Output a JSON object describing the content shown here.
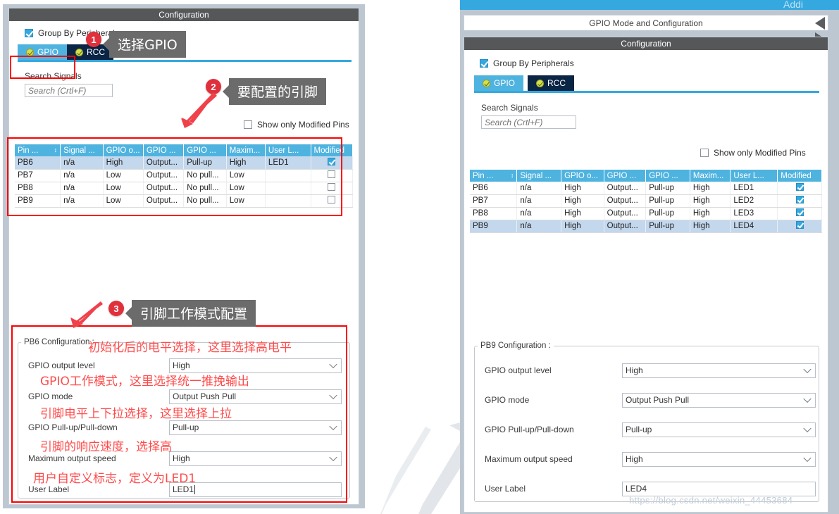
{
  "left_panel": {
    "title_bar": "Configuration",
    "group_by_peripherals": "Group By Peripherals",
    "tabs": [
      {
        "label": "GPIO",
        "state": "active"
      },
      {
        "label": "RCC",
        "state": "inactive"
      }
    ],
    "search_label": "Search Signals",
    "search_placeholder": "Search (Crtl+F)",
    "show_only_modified": "Show only Modified Pins",
    "table": {
      "headers": [
        "Pin ...",
        "Signal ...",
        "GPIO o...",
        "GPIO ...",
        "GPIO ...",
        "Maxim...",
        "User L...",
        "Modified"
      ],
      "sort_column": "Pin ...",
      "rows": [
        {
          "pin": "PB6",
          "signal": "n/a",
          "output_level": "High",
          "mode": "Output...",
          "pull": "Pull-up",
          "speed": "High",
          "user_label": "LED1",
          "modified": true,
          "selected": true
        },
        {
          "pin": "PB7",
          "signal": "n/a",
          "output_level": "Low",
          "mode": "Output...",
          "pull": "No pull...",
          "speed": "Low",
          "user_label": "",
          "modified": false,
          "selected": false
        },
        {
          "pin": "PB8",
          "signal": "n/a",
          "output_level": "Low",
          "mode": "Output...",
          "pull": "No pull...",
          "speed": "Low",
          "user_label": "",
          "modified": false,
          "selected": false
        },
        {
          "pin": "PB9",
          "signal": "n/a",
          "output_level": "Low",
          "mode": "Output...",
          "pull": "No pull...",
          "speed": "Low",
          "user_label": "",
          "modified": false,
          "selected": false
        }
      ]
    },
    "config": {
      "legend": "PB6 Configuration :",
      "fields": [
        {
          "label": "GPIO output level",
          "value": "High",
          "type": "combo"
        },
        {
          "label": "GPIO mode",
          "value": "Output Push Pull",
          "type": "combo"
        },
        {
          "label": "GPIO Pull-up/Pull-down",
          "value": "Pull-up",
          "type": "combo"
        },
        {
          "label": "Maximum output speed",
          "value": "High",
          "type": "combo"
        },
        {
          "label": "User Label",
          "value": "LED1",
          "type": "text"
        }
      ]
    }
  },
  "right_panel": {
    "top_cut_text": "Addi",
    "mode_header": "GPIO Mode and Configuration",
    "title_bar": "Configuration",
    "group_by_peripherals": "Group By Peripherals",
    "tabs": [
      {
        "label": "GPIO",
        "state": "active"
      },
      {
        "label": "RCC",
        "state": "inactive"
      }
    ],
    "search_label": "Search Signals",
    "search_placeholder": "Search (Crtl+F)",
    "show_only_modified": "Show only Modified Pins",
    "table": {
      "headers": [
        "Pin ...",
        "Signal ...",
        "GPIO o...",
        "GPIO ...",
        "GPIO ...",
        "Maxim...",
        "User L...",
        "Modified"
      ],
      "sort_column": "Pin ...",
      "rows": [
        {
          "pin": "PB6",
          "signal": "n/a",
          "output_level": "High",
          "mode": "Output...",
          "pull": "Pull-up",
          "speed": "High",
          "user_label": "LED1",
          "modified": true,
          "selected": false
        },
        {
          "pin": "PB7",
          "signal": "n/a",
          "output_level": "High",
          "mode": "Output...",
          "pull": "Pull-up",
          "speed": "High",
          "user_label": "LED2",
          "modified": true,
          "selected": false
        },
        {
          "pin": "PB8",
          "signal": "n/a",
          "output_level": "High",
          "mode": "Output...",
          "pull": "Pull-up",
          "speed": "High",
          "user_label": "LED3",
          "modified": true,
          "selected": false
        },
        {
          "pin": "PB9",
          "signal": "n/a",
          "output_level": "High",
          "mode": "Output...",
          "pull": "Pull-up",
          "speed": "High",
          "user_label": "LED4",
          "modified": true,
          "selected": true
        }
      ]
    },
    "config": {
      "legend": "PB9 Configuration :",
      "fields": [
        {
          "label": "GPIO output level",
          "value": "High",
          "type": "combo"
        },
        {
          "label": "GPIO mode",
          "value": "Output Push Pull",
          "type": "combo"
        },
        {
          "label": "GPIO Pull-up/Pull-down",
          "value": "Pull-up",
          "type": "combo"
        },
        {
          "label": "Maximum output speed",
          "value": "High",
          "type": "combo"
        },
        {
          "label": "User Label",
          "value": "LED4",
          "type": "text"
        }
      ]
    }
  },
  "annotations": {
    "badges": [
      "1",
      "2",
      "3"
    ],
    "callouts": [
      "选择GPIO",
      "要配置的引脚",
      "引脚工作模式配置"
    ],
    "red_notes": [
      "初始化后的电平选择，这里选择高电平",
      "GPIO工作模式，这里选择统一推挽输出",
      "引脚电平上下拉选择，这里选择上拉",
      "引脚的响应速度，选择高",
      "用户自定义标志，定义为LED1"
    ]
  },
  "watermark": "https://blog.csdn.net/weixin_44453684",
  "colors": {
    "accent_blue": "#4fb3e0",
    "tab_inactive": "#0b2545",
    "title_gray": "#555759",
    "annotation_red": "#fd0000",
    "badge_red": "#e0303c",
    "callout_gray": "#6b6b6b"
  }
}
